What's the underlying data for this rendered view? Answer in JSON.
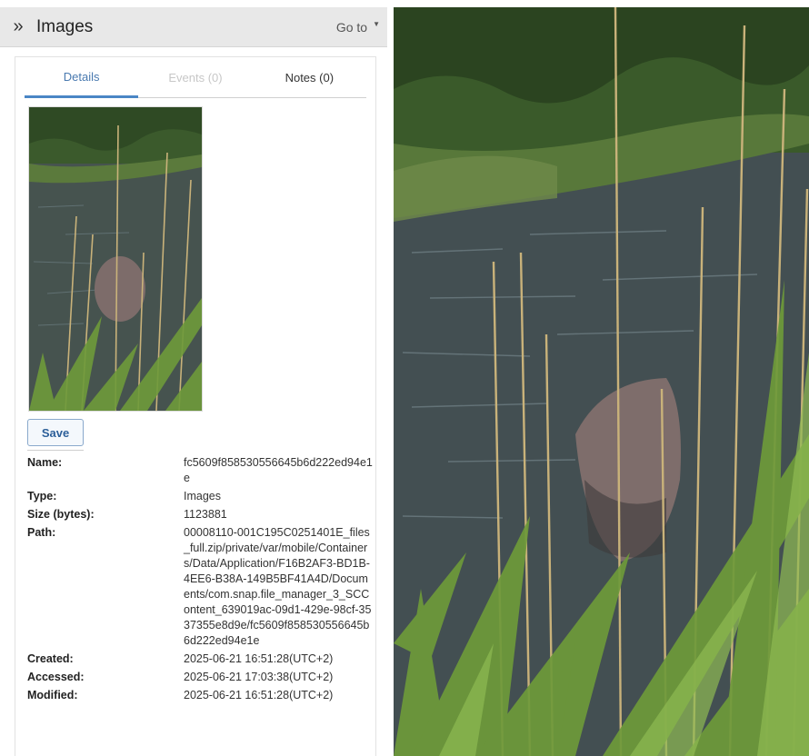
{
  "header": {
    "expand_icon": "double-chevron-right-icon",
    "expand_glyph": "»",
    "title": "Images",
    "goto_label": "Go to"
  },
  "tabs": [
    {
      "label": "Details",
      "state": "active"
    },
    {
      "label": "Events (0)",
      "state": "disabled"
    },
    {
      "label": "Notes (0)",
      "state": "normal"
    }
  ],
  "save_label": "Save",
  "properties": [
    {
      "label": "Name:",
      "value": "fc5609f858530556645b6d222ed94e1e"
    },
    {
      "label": "Type:",
      "value": "Images"
    },
    {
      "label": "Size (bytes):",
      "value": "1123881"
    },
    {
      "label": "Path:",
      "value": "00008110-001C195C0251401E_files_full.zip/private/var/mobile/Containers/Data/Application/F16B2AF3-BD1B-4EE6-B38A-149B5BF41A4D/Documents/com.snap.file_manager_3_SCContent_639019ac-09d1-429e-98cf-3537355e8d9e/fc5609f858530556645b6d222ed94e1e"
    },
    {
      "label": "Created:",
      "value": "2025-06-21 16:51:28(UTC+2)"
    },
    {
      "label": "Accessed:",
      "value": "2025-06-21 17:03:38(UTC+2)"
    },
    {
      "label": "Modified:",
      "value": "2025-06-21 16:51:28(UTC+2)"
    }
  ],
  "colors": {
    "accent": "#4a86c5",
    "header_bg": "#e8e8e8",
    "water": "#3f4a4f",
    "foliage": "#3e5a2e",
    "reed": "#c9b27a",
    "grass": "#6e9a3a"
  }
}
